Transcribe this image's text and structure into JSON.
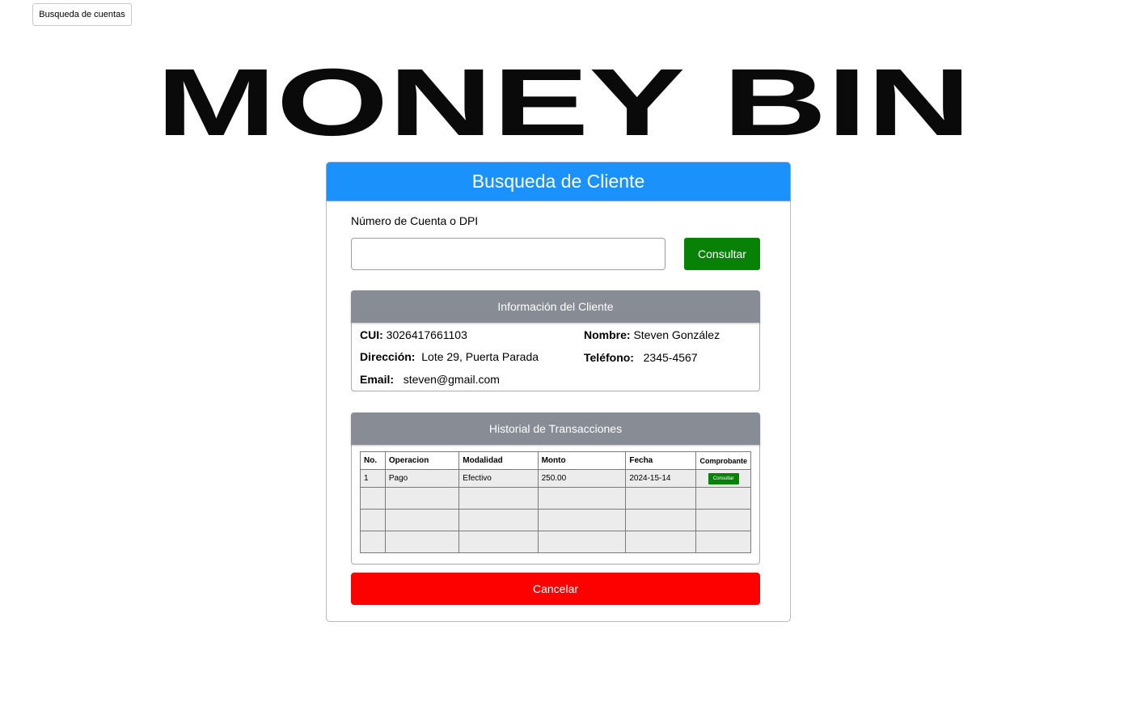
{
  "nav": {
    "tab_label": "Busqueda de cuentas"
  },
  "logo": {
    "text": "MONEY BIN"
  },
  "card": {
    "title": "Busqueda de Cliente",
    "search": {
      "label": "Número de Cuenta o DPI",
      "value": "",
      "placeholder": "",
      "button_label": "Consultar"
    },
    "client_info": {
      "title": "Información del Cliente",
      "cui_label": "CUI:",
      "cui_value": "3026417661103",
      "nombre_label": "Nombre:",
      "nombre_value": "Steven González",
      "direccion_label": "Dirección:",
      "direccion_value": "Lote 29, Puerta Parada",
      "telefono_label": "Teléfono:",
      "telefono_value": "2345-4567",
      "email_label": "Email:",
      "email_value": "steven@gmail.com"
    },
    "history": {
      "title": "Historial de Transacciones",
      "columns": [
        "No.",
        "Operacion",
        "Modalidad",
        "Monto",
        "Fecha",
        "Comprobante"
      ],
      "rows": [
        {
          "no": "1",
          "operacion": "Pago",
          "modalidad": "Efectivo",
          "monto": "250.00",
          "fecha": "2024-15-14",
          "comprobante_label": "Consultar"
        }
      ]
    },
    "cancel_label": "Cancelar"
  },
  "colors": {
    "header_blue": "#1b92fb",
    "section_gray": "#888c95",
    "consult_green": "#078207",
    "cancel_red": "#fd0000"
  }
}
